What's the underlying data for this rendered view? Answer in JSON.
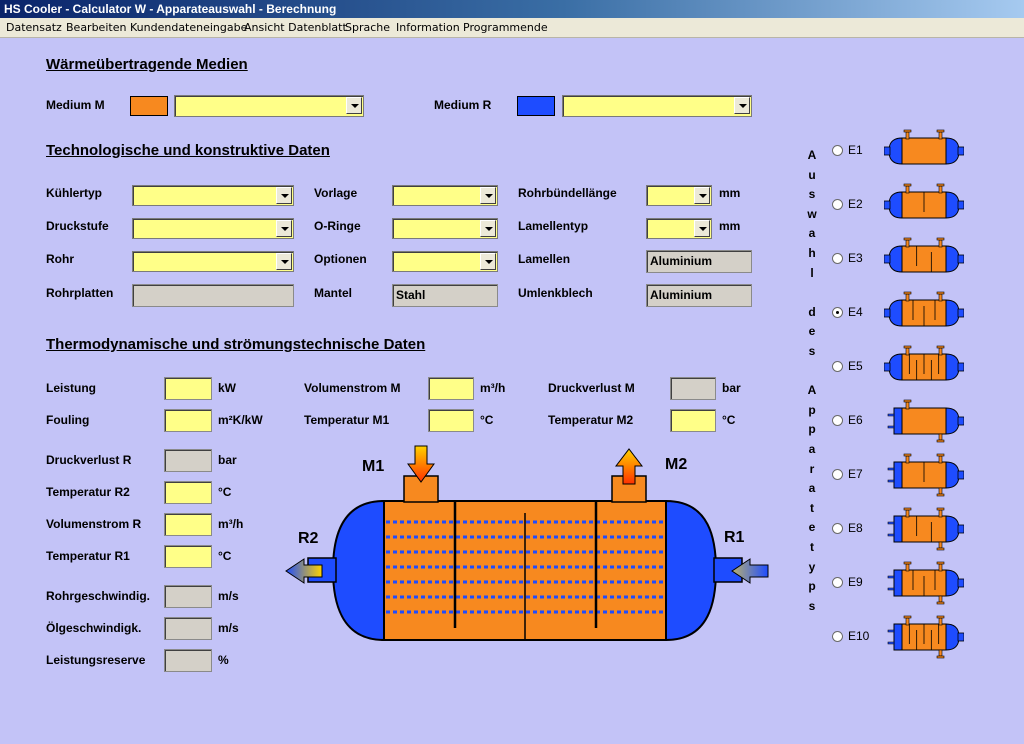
{
  "window": {
    "title": "HS Cooler - Calculator W - Apparateauswahl - Berechnung"
  },
  "menu": [
    "Datensatz",
    "Bearbeiten",
    "Kundendateneingabe",
    "Ansicht Datenblatt",
    "Sprache",
    "Information",
    "Programmende"
  ],
  "media": {
    "title": "Wärmeübertragende Medien",
    "m_label": "Medium M",
    "m_color": "#f7891f",
    "m_value": "",
    "r_label": "Medium R",
    "r_color": "#1e4cff",
    "r_value": ""
  },
  "tech": {
    "title": "Technologische und konstruktive Daten",
    "kuehlertyp": "Kühlertyp",
    "druckstufe": "Druckstufe",
    "rohr": "Rohr",
    "rohrplatten": "Rohrplatten",
    "vorlage": "Vorlage",
    "oringe": "O-Ringe",
    "optionen": "Optionen",
    "mantel": "Mantel",
    "mantel_value": "Stahl",
    "rohrbuendellaenge": "Rohrbündellänge",
    "lamellentyp": "Lamellentyp",
    "lamellen": "Lamellen",
    "lamellen_value": "Aluminium",
    "umlenkblech": "Umlenkblech",
    "umlenkblech_value": "Aluminium",
    "mm": "mm"
  },
  "thermo": {
    "title": "Thermodynamische und strömungstechnische Daten",
    "leistung": "Leistung",
    "leistung_unit": "kW",
    "fouling": "Fouling",
    "fouling_unit": "m²K/kW",
    "druckverlust_r": "Druckverlust R",
    "druckverlust_r_unit": "bar",
    "temperatur_r2": "Temperatur R2",
    "temperatur_r2_unit": "°C",
    "volumenstrom_r": "Volumenstrom R",
    "volumenstrom_r_unit": "m³/h",
    "temperatur_r1": "Temperatur R1",
    "temperatur_r1_unit": "°C",
    "rohrgeschwindig": "Rohrgeschwindig.",
    "rohrgeschwindig_unit": "m/s",
    "oelgeschwindig": "Ölgeschwindigk.",
    "oelgeschwindig_unit": "m/s",
    "leistungsreserve": "Leistungsreserve",
    "leistungsreserve_unit": "%",
    "volumenstrom_m": "Volumenstrom M",
    "volumenstrom_m_unit": "m³/h",
    "temperatur_m1": "Temperatur M1",
    "temperatur_m1_unit": "°C",
    "druckverlust_m": "Druckverlust M",
    "druckverlust_m_unit": "bar",
    "temperatur_m2": "Temperatur M2",
    "temperatur_m2_unit": "°C"
  },
  "diagram": {
    "m1": "M1",
    "m2": "M2",
    "r1": "R1",
    "r2": "R2"
  },
  "selection": {
    "vertical_label": "Auswahl des Apparatetyps",
    "options": [
      "E1",
      "E2",
      "E3",
      "E4",
      "E5",
      "E6",
      "E7",
      "E8",
      "E9",
      "E10"
    ],
    "selected": "E4"
  },
  "colors": {
    "orange": "#f7891f",
    "blue": "#1e4cff",
    "input_yellow": "#ffff88",
    "background": "#c3c3f7"
  }
}
